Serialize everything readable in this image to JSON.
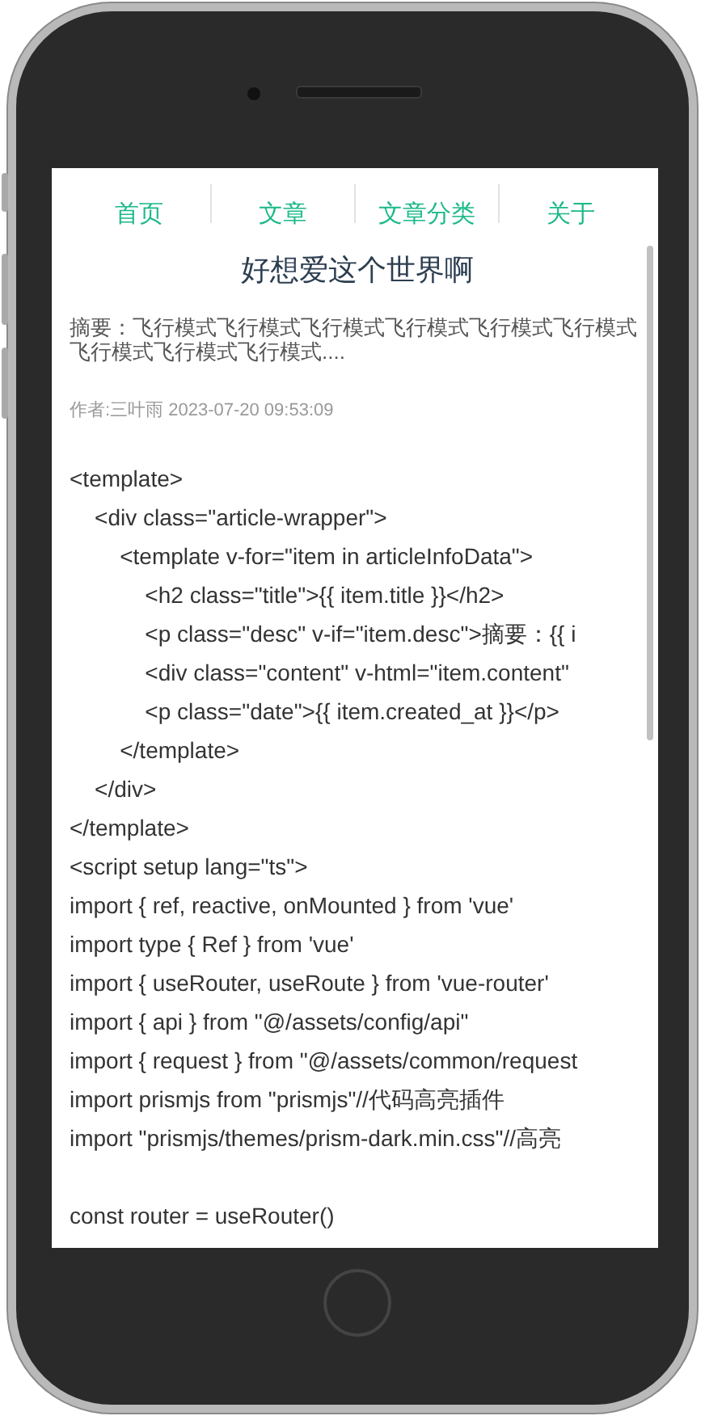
{
  "nav": [
    {
      "label": "首页"
    },
    {
      "label": "文章"
    },
    {
      "label": "文章分类"
    },
    {
      "label": "关于"
    }
  ],
  "article": {
    "title": "好想爱这个世界啊",
    "summary": "摘要：飞行模式飞行模式飞行模式飞行模式飞行模式飞行模式飞行模式飞行模式飞行模式....",
    "meta": "作者:三叶雨 2023-07-20 09:53:09",
    "code_sections": [
      [
        "<template>",
        "    <div class=\"article-wrapper\">",
        "        <template v-for=\"item in articleInfoData\">",
        "            <h2 class=\"title\">{{ item.title }}</h2>",
        "            <p class=\"desc\" v-if=\"item.desc\">摘要：{{ i",
        "            <div class=\"content\" v-html=\"item.content\"",
        "            <p class=\"date\">{{ item.created_at }}</p>",
        "        </template>",
        "    </div>",
        "</template>",
        "<script setup lang=\"ts\">",
        "import { ref, reactive, onMounted } from 'vue'",
        "import type { Ref } from 'vue'",
        "import { useRouter, useRoute } from 'vue-router'",
        "import { api } from \"@/assets/config/api\"",
        "import { request } from \"@/assets/common/request",
        "import prismjs from \"prismjs\"//代码高亮插件",
        "import \"prismjs/themes/prism-dark.min.css\"//高亮"
      ],
      [
        "const router = useRouter()"
      ]
    ]
  }
}
